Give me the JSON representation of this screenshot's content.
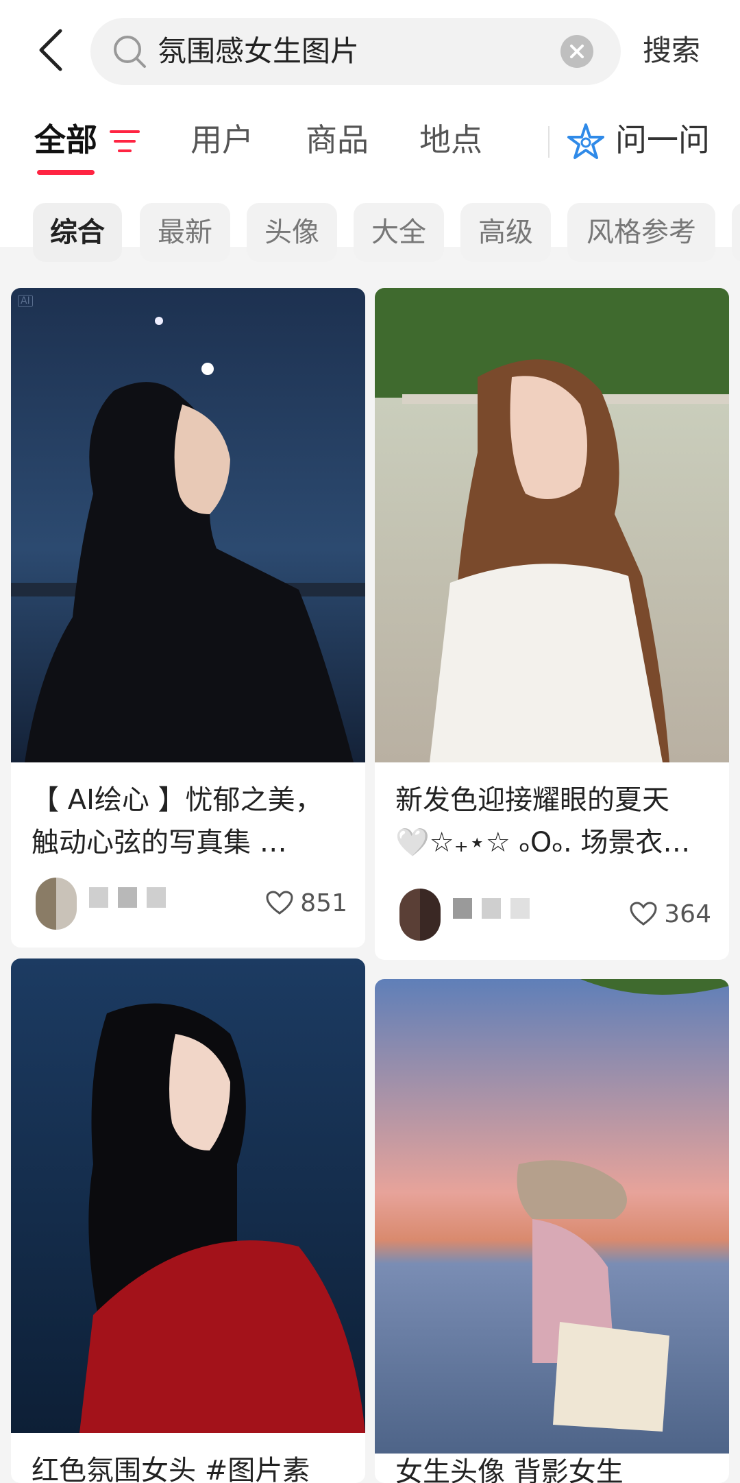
{
  "header": {
    "search_query": "氛围感女生图片",
    "search_button": "搜索"
  },
  "tabs": {
    "items": [
      "全部",
      "用户",
      "商品",
      "地点"
    ],
    "ask_label": "问一问"
  },
  "chips": [
    "综合",
    "最新",
    "头像",
    "大全",
    "高级",
    "风格参考"
  ],
  "cards": [
    {
      "title_line1": "【 AI绘心 】忧郁之美，",
      "title_line2": "触动心弦的写真集 …",
      "likes": "851",
      "ai_badge": "AI"
    },
    {
      "title_line1": "新发色迎接耀眼的夏天",
      "title_line2": "🤍☆₊⋆☆ ₒOₒ. 场景衣…",
      "likes": "364"
    },
    {
      "title_line1": "红色氛围女头 #图片素"
    },
    {
      "title_line1": "女生头像 背影女生"
    }
  ],
  "colors": {
    "accent": "#ff2442",
    "ask_icon": "#2f8ae8"
  }
}
